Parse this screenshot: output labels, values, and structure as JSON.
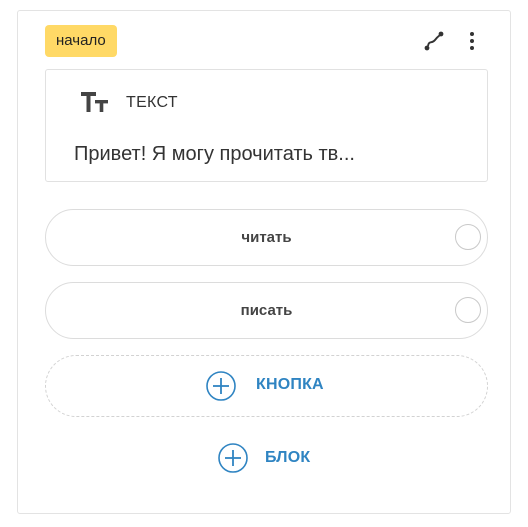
{
  "card": {
    "badge": "начало",
    "icons": {
      "route": "route-icon",
      "more": "more-vertical-icon"
    }
  },
  "text_block": {
    "icon": "text-format-icon",
    "type_label": "ТЕКСТ",
    "preview": "Привет! Я могу прочитать тв..."
  },
  "answers": [
    {
      "label": "читать"
    },
    {
      "label": "писать"
    }
  ],
  "actions": {
    "add_button_label": "КНОПКА",
    "add_block_label": "БЛОК",
    "plus_icon": "plus-circle-icon"
  },
  "colors": {
    "badge": "#ffd966",
    "accent": "#2f84c2"
  }
}
